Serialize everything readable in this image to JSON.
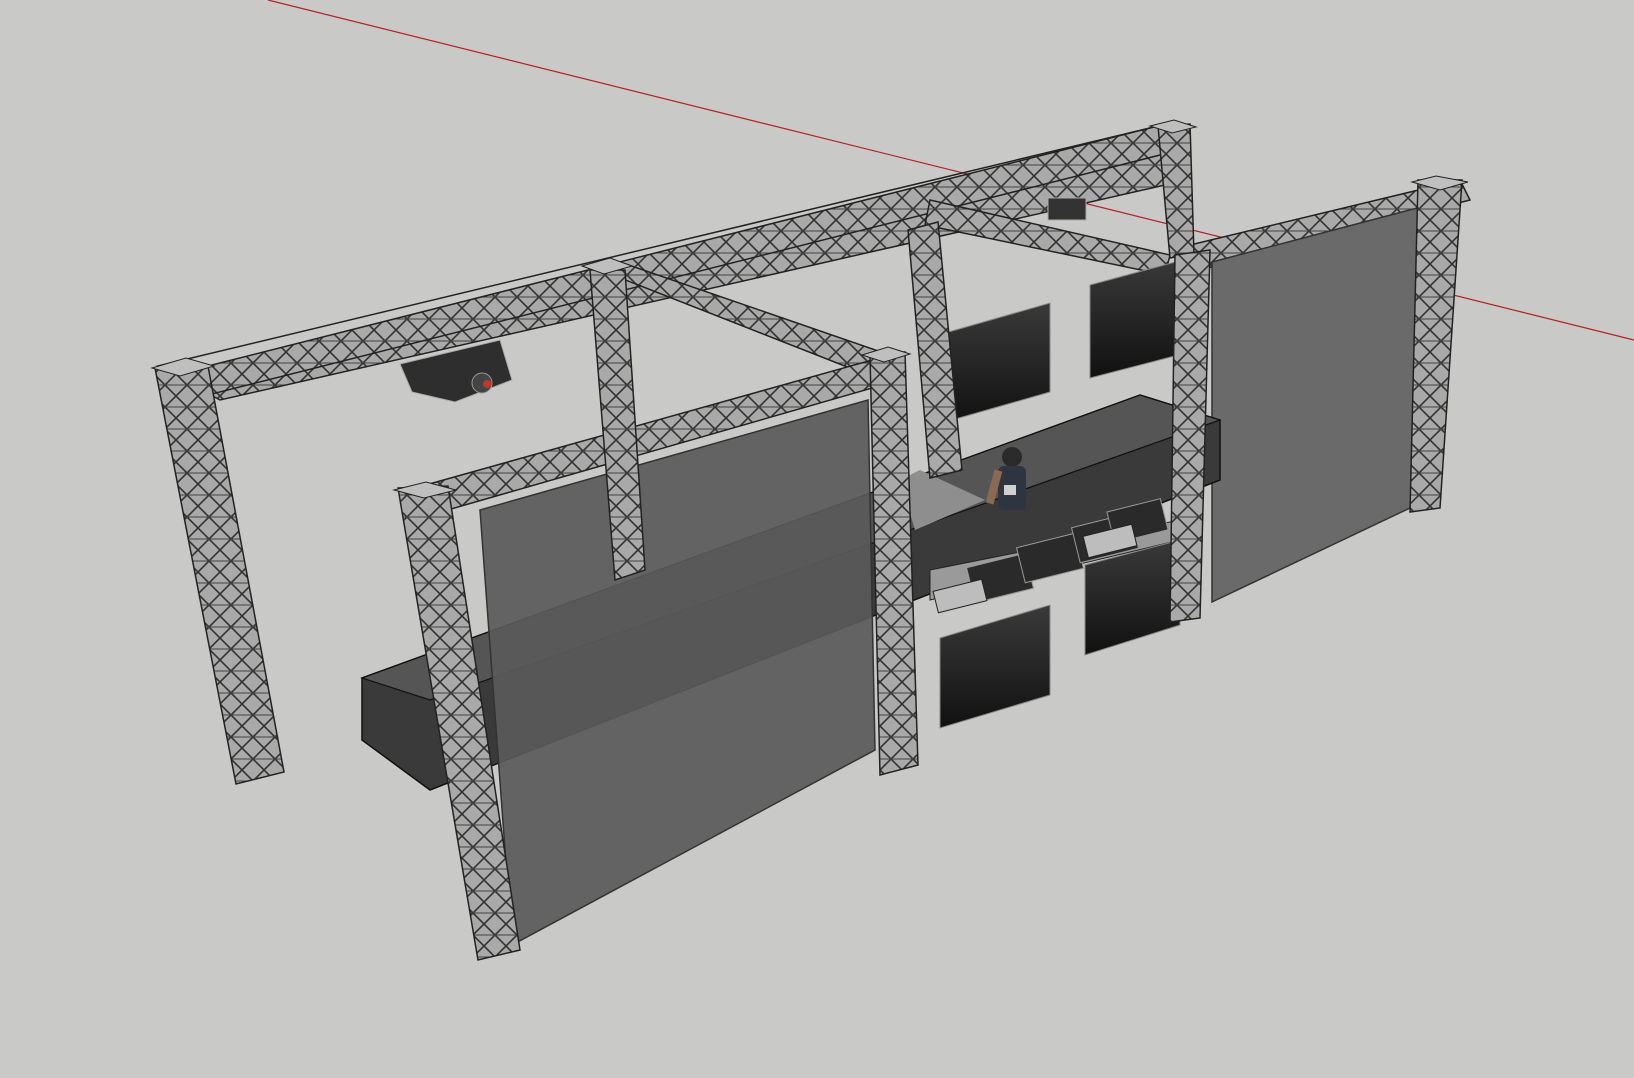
{
  "viewport": {
    "background": "#c9c9c7",
    "axis_color": "#b22222"
  },
  "model": {
    "truss_color": "#a8a8a8",
    "truss_line": "#2a2a2a",
    "screen_fill": "#505050",
    "platform_fill": "#3c3c3c",
    "led_panel_fill": "#222222",
    "objects": [
      {
        "name": "truss-frame",
        "icon": "truss-icon"
      },
      {
        "name": "projector",
        "icon": "projector-icon"
      },
      {
        "name": "projection-screen-front",
        "icon": "screen-icon"
      },
      {
        "name": "projection-screen-right",
        "icon": "screen-icon"
      },
      {
        "name": "dj-booth",
        "icon": "booth-icon"
      },
      {
        "name": "led-panels",
        "icon": "panel-icon"
      },
      {
        "name": "dj-figure",
        "icon": "person-icon"
      }
    ]
  }
}
